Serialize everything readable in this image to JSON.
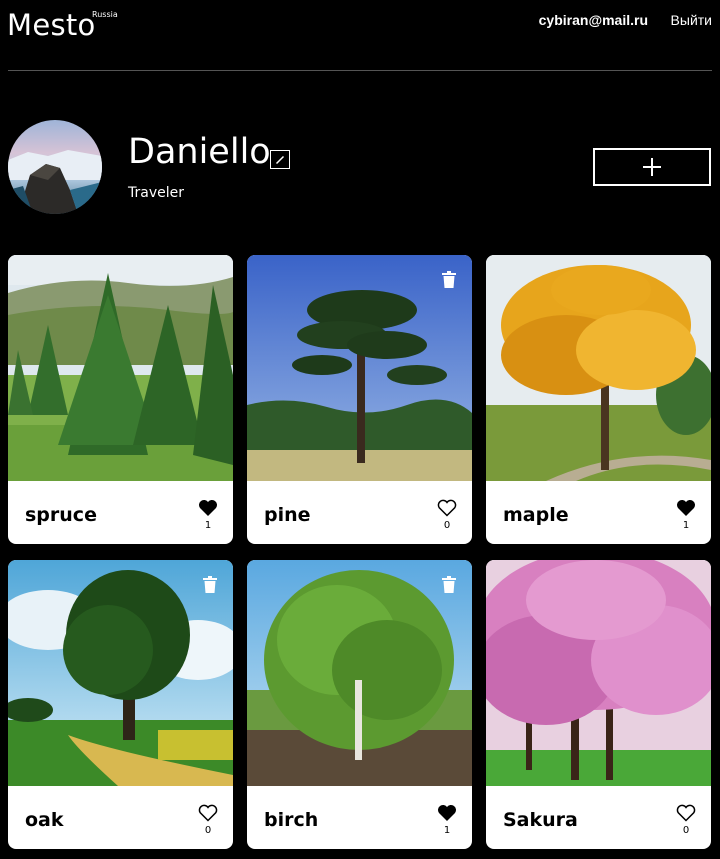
{
  "header": {
    "logo": "Mesto",
    "logo_sup": "Russia",
    "email": "cybiran@mail.ru",
    "logout": "Выйти"
  },
  "profile": {
    "name": "Daniello",
    "about": "Traveler",
    "add_icon": "plus-icon",
    "edit_icon": "pencil-icon"
  },
  "cards": [
    {
      "title": "spruce",
      "likes": "1",
      "liked": true,
      "deletable": false
    },
    {
      "title": "pine",
      "likes": "0",
      "liked": false,
      "deletable": true
    },
    {
      "title": "maple",
      "likes": "1",
      "liked": true,
      "deletable": false
    },
    {
      "title": "oak",
      "likes": "0",
      "liked": false,
      "deletable": true
    },
    {
      "title": "birch",
      "likes": "1",
      "liked": true,
      "deletable": true
    },
    {
      "title": "Sakura",
      "likes": "0",
      "liked": false,
      "deletable": false
    }
  ],
  "colors": {
    "background": "#000000",
    "card": "#ffffff",
    "divider": "#545454"
  }
}
